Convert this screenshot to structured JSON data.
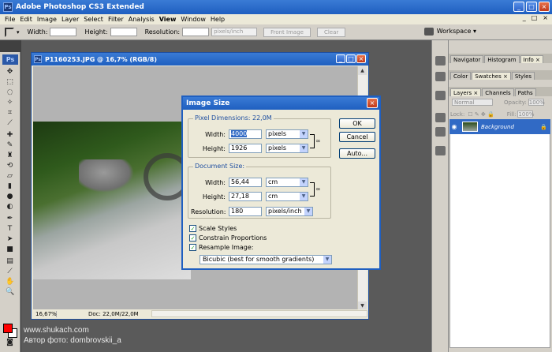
{
  "app": {
    "title": "Adobe Photoshop CS3 Extended",
    "logo": "Ps",
    "window_controls": [
      "_",
      "□",
      "×"
    ]
  },
  "menu": {
    "items": [
      "File",
      "Edit",
      "Image",
      "Layer",
      "Select",
      "Filter",
      "Analysis",
      "View",
      "Window",
      "Help"
    ],
    "active": "View"
  },
  "options_bar": {
    "width_label": "Width:",
    "height_label": "Height:",
    "resolution_label": "Resolution:",
    "resolution_unit": "pixels/inch",
    "front_image_label": "Front Image",
    "clear_label": "Clear",
    "workspace_label": "Workspace ▾"
  },
  "document": {
    "title": "P1160253.JPG @ 16,7% (RGB/8)",
    "zoom": "16,67%",
    "doc_size": "Doc: 22,0M/22,0M"
  },
  "image_size_dialog": {
    "title": "Image Size",
    "pixel_dimensions_label": "Pixel Dimensions:  22,0M",
    "pixel_width_label": "Width:",
    "pixel_width_value": "4000",
    "pixel_width_unit": "pixels",
    "pixel_height_label": "Height:",
    "pixel_height_value": "1926",
    "pixel_height_unit": "pixels",
    "document_size_label": "Document Size:",
    "doc_width_label": "Width:",
    "doc_width_value": "56,44",
    "doc_width_unit": "cm",
    "doc_height_label": "Height:",
    "doc_height_value": "27,18",
    "doc_height_unit": "cm",
    "resolution_label": "Resolution:",
    "resolution_value": "180",
    "resolution_unit": "pixels/inch",
    "scale_styles_label": "Scale Styles",
    "constrain_label": "Constrain Proportions",
    "resample_label": "Resample Image:",
    "resample_method": "Bicubic (best for smooth gradients)",
    "ok_label": "OK",
    "cancel_label": "Cancel",
    "auto_label": "Auto..."
  },
  "panels": {
    "top_tabs": [
      "Navigator",
      "Histogram",
      "Info ×"
    ],
    "mid_tabs": [
      "Color",
      "Swatches ×",
      "Styles"
    ],
    "layer_tabs": [
      "Layers ×",
      "Channels",
      "Paths"
    ],
    "blend_mode": "Normal",
    "opacity_label": "Opacity:",
    "opacity_value": "100%",
    "lock_label": "Lock:",
    "fill_label": "Fill:",
    "fill_value": "100%",
    "layer_name": "Background"
  },
  "watermark": {
    "line1": "www.shukach.com",
    "line2": "Автор фото: dombrovskii_a"
  },
  "colors": {
    "foreground": "#ff0000",
    "background": "#ffffff",
    "accent": "#1f5fc0",
    "selection": "#316ac5"
  }
}
